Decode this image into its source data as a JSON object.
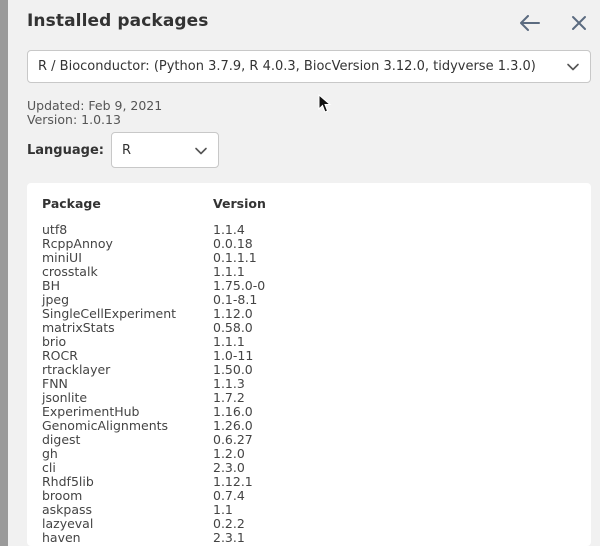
{
  "dialog": {
    "title": "Installed packages",
    "back_icon": "arrow-left-icon",
    "close_icon": "close-icon"
  },
  "environment": {
    "selected": "R / Bioconductor: (Python 3.7.9, R 4.0.3, BiocVersion 3.12.0, tidyverse 1.3.0)"
  },
  "meta": {
    "updated": "Updated: Feb 9, 2021",
    "version": "Version: 1.0.13"
  },
  "language": {
    "label": "Language:",
    "selected": "R"
  },
  "table": {
    "headers": {
      "package": "Package",
      "version": "Version"
    },
    "rows": [
      {
        "package": "utf8",
        "version": "1.1.4"
      },
      {
        "package": "RcppAnnoy",
        "version": "0.0.18"
      },
      {
        "package": "miniUI",
        "version": "0.1.1.1"
      },
      {
        "package": "crosstalk",
        "version": "1.1.1"
      },
      {
        "package": "BH",
        "version": "1.75.0-0"
      },
      {
        "package": "jpeg",
        "version": "0.1-8.1"
      },
      {
        "package": "SingleCellExperiment",
        "version": "1.12.0"
      },
      {
        "package": "matrixStats",
        "version": "0.58.0"
      },
      {
        "package": "brio",
        "version": "1.1.1"
      },
      {
        "package": "ROCR",
        "version": "1.0-11"
      },
      {
        "package": "rtracklayer",
        "version": "1.50.0"
      },
      {
        "package": "FNN",
        "version": "1.1.3"
      },
      {
        "package": "jsonlite",
        "version": "1.7.2"
      },
      {
        "package": "ExperimentHub",
        "version": "1.16.0"
      },
      {
        "package": "GenomicAlignments",
        "version": "1.26.0"
      },
      {
        "package": "digest",
        "version": "0.6.27"
      },
      {
        "package": "gh",
        "version": "1.2.0"
      },
      {
        "package": "cli",
        "version": "2.3.0"
      },
      {
        "package": "Rhdf5lib",
        "version": "1.12.1"
      },
      {
        "package": "broom",
        "version": "0.7.4"
      },
      {
        "package": "askpass",
        "version": "1.1"
      },
      {
        "package": "lazyeval",
        "version": "0.2.2"
      },
      {
        "package": "haven",
        "version": "2.3.1"
      }
    ]
  },
  "colors": {
    "panel_bg": "#f1f1f1",
    "icon": "#5b6b80",
    "border": "#c8c8c8"
  }
}
